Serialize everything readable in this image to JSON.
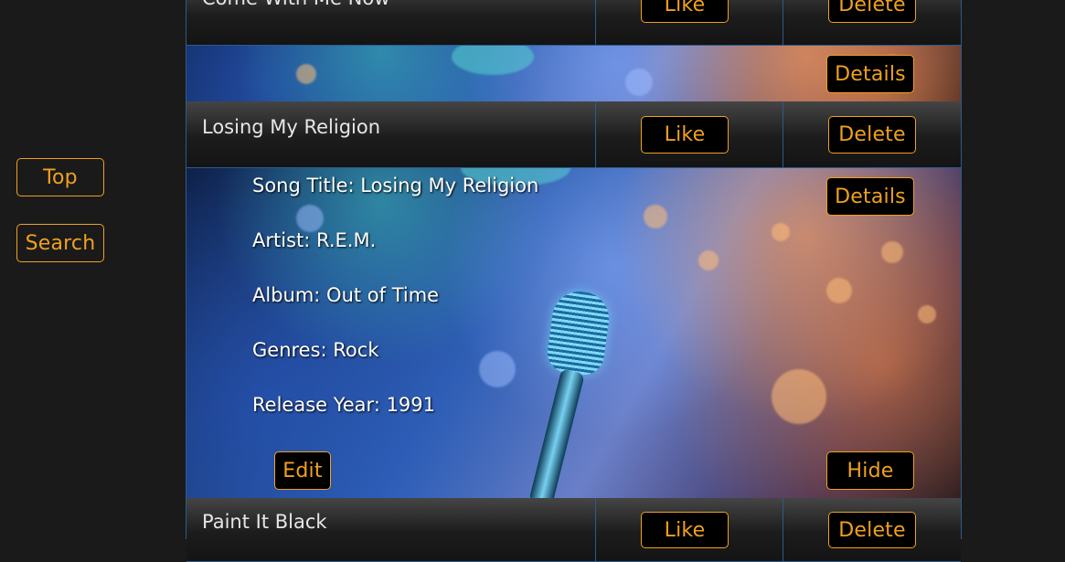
{
  "sidebar": {
    "top_label": "Top",
    "search_label": "Search"
  },
  "rows": [
    {
      "title": "Come With Me Now",
      "like_label": "Like",
      "delete_label": "Delete",
      "details_label": "Details"
    },
    {
      "title": "Losing My Religion",
      "like_label": "Like",
      "delete_label": "Delete",
      "details_label": "Details"
    },
    {
      "title": "Paint It Black",
      "like_label": "Like",
      "delete_label": "Delete"
    }
  ],
  "details": {
    "song_title": "Song Title: Losing My Religion",
    "artist": "Artist: R.E.M.",
    "album": "Album: Out of Time",
    "genres": "Genres: Rock",
    "release_year": "Release Year: 1991",
    "edit_label": "Edit",
    "hide_label": "Hide"
  },
  "colors": {
    "accent": "#f0a020",
    "border": "#2d5a8a",
    "background": "#1a1a1a"
  }
}
